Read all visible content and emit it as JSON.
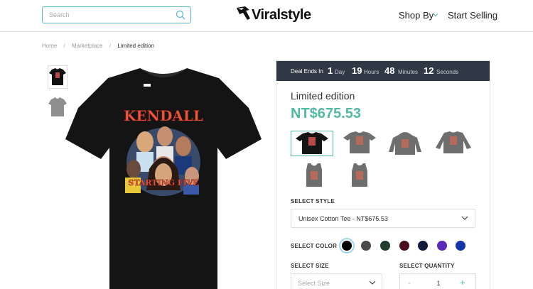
{
  "header": {
    "search_placeholder": "Search",
    "logo_text": "Viralstyle",
    "nav": {
      "shop_by": "Shop By",
      "start_selling": "Start Selling"
    }
  },
  "breadcrumb": [
    "Home",
    "Marketplace",
    "Limited edition"
  ],
  "product_image": {
    "print_line1": "KENDALL",
    "print_line2": "STARTING FIVE"
  },
  "deal": {
    "label": "Deal Ends In",
    "days": "1",
    "days_unit": "Day",
    "hours": "19",
    "hours_unit": "Hours",
    "minutes": "48",
    "minutes_unit": "Minutes",
    "seconds": "12",
    "seconds_unit": "Seconds"
  },
  "product": {
    "title": "Limited edition",
    "price": "NT$675.53"
  },
  "style": {
    "label": "SELECT STYLE",
    "selected": "Unisex Cotton Tee - NT$675.53"
  },
  "color": {
    "label": "SELECT COLOR",
    "swatches": [
      "#000000",
      "#4a4a4a",
      "#1f3d2c",
      "#4a0d1c",
      "#0f1c3d",
      "#5b2bb8",
      "#1436a8"
    ]
  },
  "size": {
    "label": "SELECT SIZE",
    "placeholder": "Select Size"
  },
  "quantity": {
    "label": "SELECT QUANTITY",
    "value": "1",
    "minus": "-",
    "plus": "+"
  },
  "colors": {
    "accent": "#54b8a2",
    "deal_bar": "#2f3844",
    "search_border": "#5ab6c8"
  }
}
